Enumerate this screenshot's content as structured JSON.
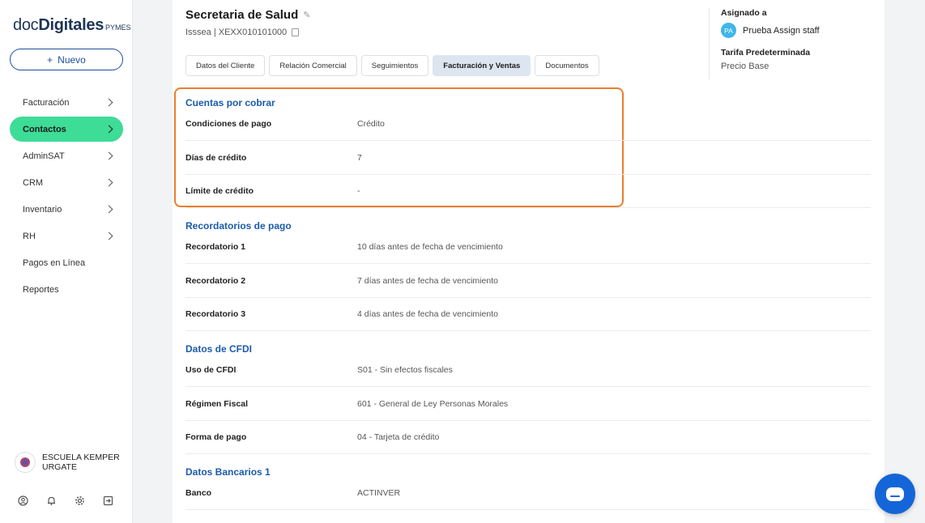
{
  "brand": {
    "doc": "doc",
    "digitales": "Digitales",
    "pymes": "PYMES"
  },
  "sidebar": {
    "new_button": {
      "icon": "+",
      "label": "Nuevo"
    },
    "items": [
      {
        "label": "Facturación",
        "has_chevron": true,
        "active": false
      },
      {
        "label": "Contactos",
        "has_chevron": true,
        "active": true
      },
      {
        "label": "AdminSAT",
        "has_chevron": true,
        "active": false
      },
      {
        "label": "CRM",
        "has_chevron": true,
        "active": false
      },
      {
        "label": "Inventario",
        "has_chevron": true,
        "active": false
      },
      {
        "label": "RH",
        "has_chevron": true,
        "active": false
      },
      {
        "label": "Pagos en Línea",
        "has_chevron": false,
        "active": false
      },
      {
        "label": "Reportes",
        "has_chevron": false,
        "active": false
      }
    ],
    "org_name": "ESCUELA KEMPER URGATE",
    "footer_icons": [
      "user-icon",
      "bell-icon",
      "gear-icon",
      "logout-icon"
    ]
  },
  "contact": {
    "name": "Secretaria de Salud",
    "subtitle": "Isssea | XEXX010101000"
  },
  "tabs": [
    {
      "label": "Datos del Cliente",
      "active": false
    },
    {
      "label": "Relación Comercial",
      "active": false
    },
    {
      "label": "Seguimientos",
      "active": false
    },
    {
      "label": "Facturación y Ventas",
      "active": true
    },
    {
      "label": "Documentos",
      "active": false
    }
  ],
  "right_panel": {
    "assigned_label": "Asignado a",
    "assignee_initials": "PA",
    "assignee_name": "Prueba Assign staff",
    "tarifa_label": "Tarifa Predeterminada",
    "tarifa_value": "Precio Base"
  },
  "sections": [
    {
      "title": "Cuentas por cobrar",
      "rows": [
        {
          "label": "Condiciones de pago",
          "value": "Crédito"
        },
        {
          "label": "Días de crédito",
          "value": "7"
        },
        {
          "label": "Límite de crédito",
          "value": "-"
        }
      ]
    },
    {
      "title": "Recordatorios de pago",
      "rows": [
        {
          "label": "Recordatorio 1",
          "value": "10 días antes de fecha de vencimiento"
        },
        {
          "label": "Recordatorio 2",
          "value": "7 días antes de fecha de vencimiento"
        },
        {
          "label": "Recordatorio 3",
          "value": "4 días antes de fecha de vencimiento"
        }
      ]
    },
    {
      "title": "Datos de CFDI",
      "rows": [
        {
          "label": "Uso de CFDI",
          "value": "S01 - Sin efectos fiscales"
        },
        {
          "label": "Régimen Fiscal",
          "value": "601 - General de Ley Personas Morales"
        },
        {
          "label": "Forma de pago",
          "value": "04 - Tarjeta de crédito"
        }
      ]
    },
    {
      "title": "Datos Bancarios 1",
      "rows": [
        {
          "label": "Banco",
          "value": "ACTINVER"
        }
      ]
    }
  ],
  "colors": {
    "accent": "#3ddc97",
    "primary": "#1c5bab",
    "highlight": "#ea7f2e",
    "chat": "#1466d8"
  }
}
